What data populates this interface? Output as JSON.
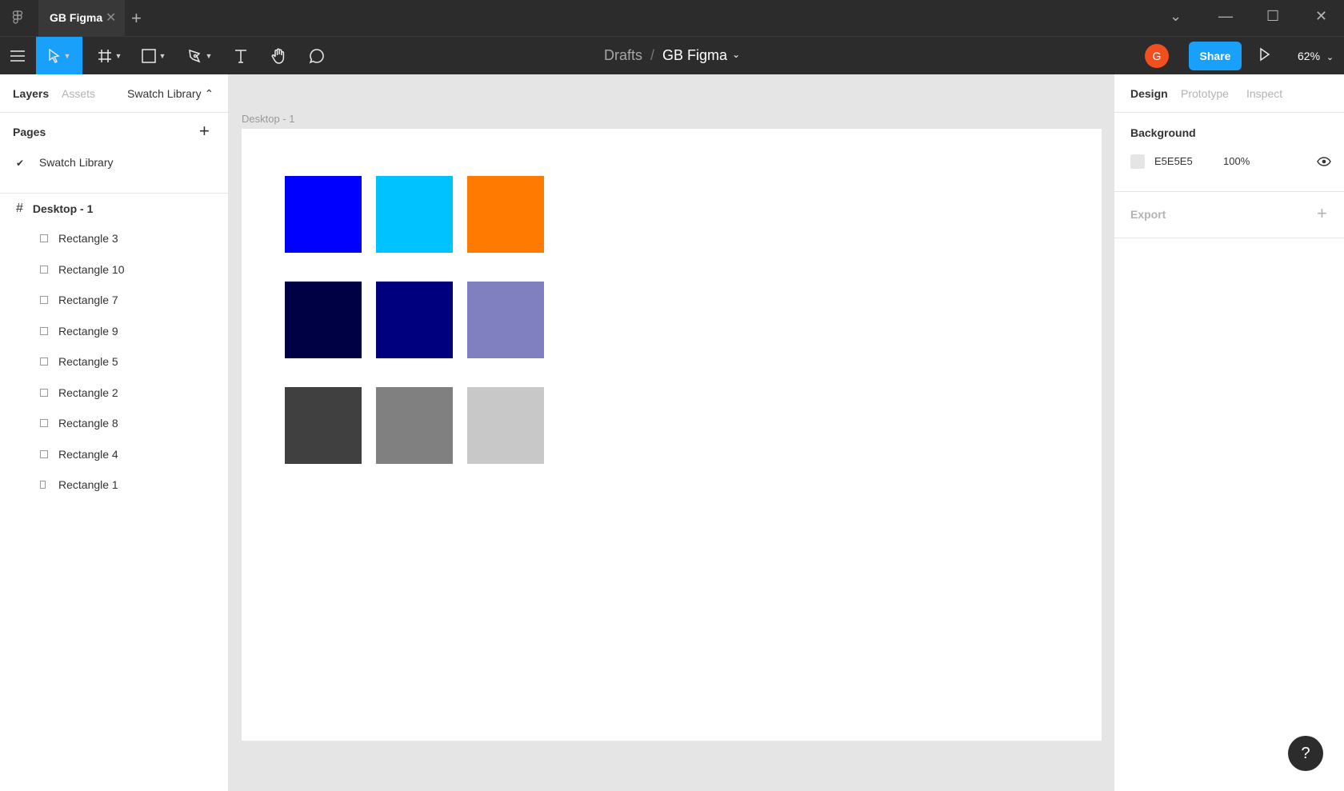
{
  "titlebar": {
    "tab_title": "GB Figma",
    "tab_close": "✕",
    "new_tab": "+",
    "dropdown": "⌄",
    "minimize": "—",
    "maximize": "☐",
    "close": "✕"
  },
  "toolbar": {
    "breadcrumb_root": "Drafts",
    "breadcrumb_sep": "/",
    "file_name": "GB Figma",
    "caret": "⌄",
    "avatar_letter": "G",
    "share_label": "Share",
    "zoom": "62%",
    "zoom_caret": "⌄"
  },
  "left_panel": {
    "tabs": [
      "Layers",
      "Assets"
    ],
    "page_dropdown": "Swatch Library ⌃",
    "pages_title": "Pages",
    "pages_add": "+",
    "page_check": "✔",
    "pages": [
      "Swatch Library"
    ],
    "frame_name": "Desktop - 1",
    "layers": [
      "Rectangle 3",
      "Rectangle 10",
      "Rectangle 7",
      "Rectangle 9",
      "Rectangle 5",
      "Rectangle 2",
      "Rectangle 8",
      "Rectangle 4",
      "Rectangle 1"
    ]
  },
  "canvas": {
    "frame_label": "Desktop - 1",
    "swatches": [
      "#0000ff",
      "#00c2ff",
      "#ff7a00",
      "#000045",
      "#00007f",
      "#8080c0",
      "#404040",
      "#808080",
      "#c8c8c8"
    ]
  },
  "right_panel": {
    "tabs": [
      "Design",
      "Prototype",
      "Inspect"
    ],
    "background_title": "Background",
    "background_hex": "E5E5E5",
    "background_opacity": "100%",
    "export_title": "Export",
    "export_add": "+"
  },
  "help": "?"
}
